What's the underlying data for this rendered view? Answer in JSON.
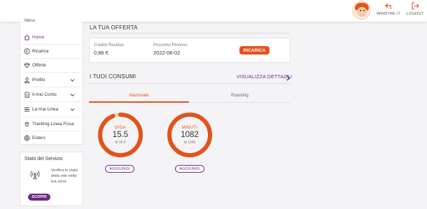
{
  "topbar": {
    "windtre_label": "WINDTRE.IT",
    "logout_label": "LOGOUT"
  },
  "sidebar": {
    "caption": "Menu",
    "items": [
      {
        "label": "Home",
        "icon": "home-icon",
        "active": true
      },
      {
        "label": "Ricarica",
        "icon": "euro-icon"
      },
      {
        "label": "Offerte",
        "icon": "diamond-icon"
      },
      {
        "label": "Profilo",
        "icon": "user-icon",
        "expandable": true
      },
      {
        "label": "Il mio Conto",
        "icon": "doc-icon",
        "expandable": true
      },
      {
        "label": "La mia Linea",
        "icon": "lines-icon",
        "expandable": true
      },
      {
        "label": "Tracking Linea Fissa",
        "icon": "truck-icon"
      },
      {
        "label": "Estero",
        "icon": "globe-icon"
      }
    ]
  },
  "service": {
    "title": "Stato del Servizio",
    "description": "Verifica lo stato della rete nella tua zona",
    "button": "SCOPRI"
  },
  "offer": {
    "section_title": "LA TUA OFFERTA",
    "credit_label": "Credito Residuo",
    "credit_value": "0,86 €",
    "renewal_label": "Prossimo Rinnovo",
    "renewal_value": "2022-06-02",
    "recharge_button": "RICARICA"
  },
  "consumption": {
    "section_title": "I TUOI CONSUMI",
    "details_link": "VISUALIZZA DETTAGLI",
    "tabs": [
      {
        "label": "Nazionale",
        "active": true
      },
      {
        "label": "Roaming",
        "active": false
      }
    ],
    "gauges": [
      {
        "title": "GIGA",
        "value": "15.5",
        "total": "di 16.5",
        "remaining_fraction": 0.94,
        "button": "AGGIUNGI"
      },
      {
        "title": "MINUTI",
        "value": "1082",
        "total": "di 1100",
        "remaining_fraction": 0.98,
        "button": "AGGIUNGI"
      }
    ]
  },
  "colors": {
    "accent": "#e2531b",
    "purple": "#6a2a8a",
    "gauge_track": "#f3d3c4"
  }
}
